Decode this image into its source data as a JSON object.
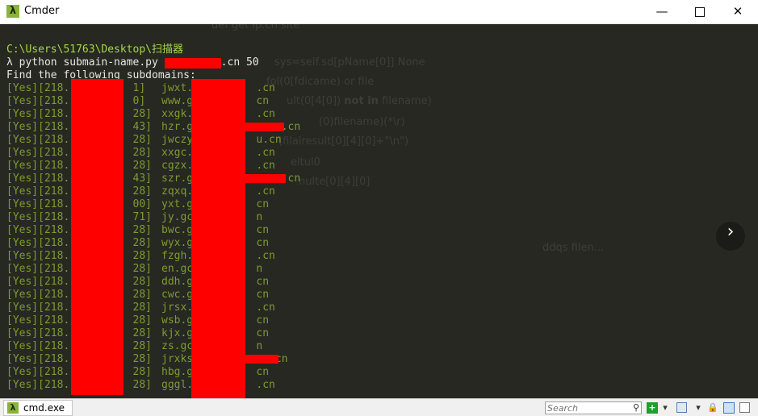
{
  "window": {
    "title": "Cmder",
    "min_glyph": "—",
    "close_glyph": "✕"
  },
  "icons": {
    "app": "λ"
  },
  "terminal": {
    "prompt_path": "C:\\Users\\51763\\Desktop\\扫描器",
    "command_prefix": "λ python submain-name.py ",
    "command_suffix": ".cn 50",
    "header": "Find the following subdomains:",
    "rows": [
      {
        "ip": "[Yes][218.          1]",
        "domain": "jwxt.          .cn"
      },
      {
        "ip": "[Yes][218.          0]",
        "domain": "www.g          cn"
      },
      {
        "ip": "[Yes][218.          28]",
        "domain": "xxgk.          .cn"
      },
      {
        "ip": "[Yes][218.          43]",
        "domain": "hzr.g              .cn"
      },
      {
        "ip": "[Yes][218.          28]",
        "domain": "jwczy          u.cn"
      },
      {
        "ip": "[Yes][218.          28]",
        "domain": "xxgc.          .cn"
      },
      {
        "ip": "[Yes][218.          28]",
        "domain": "cgzx.          .cn"
      },
      {
        "ip": "[Yes][218.          43]",
        "domain": "szr.g              .cn"
      },
      {
        "ip": "[Yes][218.          28]",
        "domain": "zqxq.          .cn"
      },
      {
        "ip": "[Yes][218.          00]",
        "domain": "yxt.g          cn"
      },
      {
        "ip": "[Yes][218.          71]",
        "domain": "jy.gc          n"
      },
      {
        "ip": "[Yes][218.          28]",
        "domain": "bwc.g          cn"
      },
      {
        "ip": "[Yes][218.          28]",
        "domain": "wyx.g          cn"
      },
      {
        "ip": "[Yes][218.          28]",
        "domain": "fzgh.          .cn"
      },
      {
        "ip": "[Yes][218.          28]",
        "domain": "en.gc          n"
      },
      {
        "ip": "[Yes][218.          28]",
        "domain": "ddh.g          cn"
      },
      {
        "ip": "[Yes][218.          28]",
        "domain": "cwc.g          cn"
      },
      {
        "ip": "[Yes][218.          28]",
        "domain": "jrsx.          .cn"
      },
      {
        "ip": "[Yes][218.          28]",
        "domain": "wsb.g          cn"
      },
      {
        "ip": "[Yes][218.          28]",
        "domain": "kjx.g          cn"
      },
      {
        "ip": "[Yes][218.          28]",
        "domain": "zs.gc          n"
      },
      {
        "ip": "[Yes][218.          28]",
        "domain": "jrxks             cn"
      },
      {
        "ip": "[Yes][218.          28]",
        "domain": "hbg.g          cn"
      },
      {
        "ip": "[Yes][218.          28]",
        "domain": "gggl.          .cn"
      }
    ],
    "ghost_text": {
      "l1": "def get ip.cn site",
      "l2": "sys=self.sd[pName[0]] None",
      "l3": "fol(0[fdicame) or file",
      "l4a": "ult(0[4[0]) ",
      "l4b": "not in",
      "l4c": " filename)",
      "l5": "(0)filename)(*\\r)",
      "l6": "(filairesult[0][4][0]+\"\\n\")",
      "l7": "eltul0",
      "l8": "nulte[0][4][0]",
      "l9": "ddqs filen..."
    },
    "nav_glyph": "›"
  },
  "statusbar": {
    "tab_label": "cmd.exe",
    "search_placeholder": "Search",
    "search_glyph": "⚲",
    "plus_glyph": "+",
    "dd_glyph": "▾",
    "lock_glyph": "🔒"
  }
}
